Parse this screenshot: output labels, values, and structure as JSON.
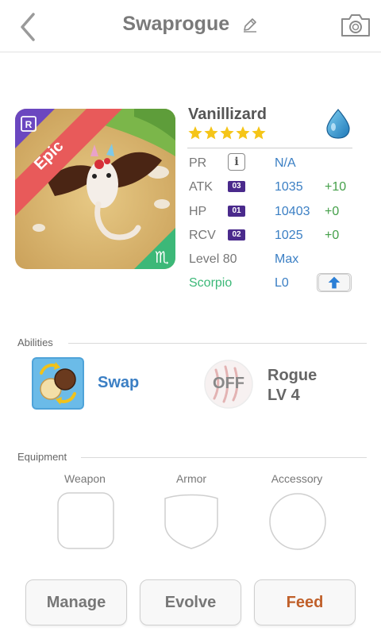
{
  "header": {
    "title": "Swaprogue",
    "back_icon": "back-chevron-icon",
    "edit_icon": "pencil-icon",
    "camera_icon": "camera-icon"
  },
  "monster": {
    "name": "Vanillizard",
    "rarity": "Epic",
    "rank_badge": "R",
    "zodiac_symbol": "♏",
    "star_count": 5,
    "element_icon": "water-drop-icon",
    "stats": {
      "pr": {
        "label": "PR",
        "value": "N/A"
      },
      "atk": {
        "label": "ATK",
        "badge": "03",
        "value": "1035",
        "bonus": "+10"
      },
      "hp": {
        "label": "HP",
        "badge": "01",
        "value": "10403",
        "bonus": "+0"
      },
      "rcv": {
        "label": "RCV",
        "badge": "02",
        "value": "1025",
        "bonus": "+0"
      },
      "level": {
        "label": "Level 80",
        "value": "Max"
      },
      "zodiac": {
        "label": "Scorpio",
        "value": "L0"
      }
    }
  },
  "abilities": {
    "section_title": "Abilities",
    "swap": {
      "name": "Swap"
    },
    "rogue": {
      "state": "OFF",
      "name": "Rogue",
      "level": "LV 4"
    }
  },
  "equipment": {
    "section_title": "Equipment",
    "weapon_label": "Weapon",
    "armor_label": "Armor",
    "accessory_label": "Accessory"
  },
  "actions": {
    "manage": "Manage",
    "evolve": "Evolve",
    "feed": "Feed"
  },
  "colors": {
    "value_blue": "#3b7fc4",
    "bonus_green": "#45a04a",
    "zodiac_green": "#3cb878",
    "badge_purple": "#4a2a8c",
    "feed_orange": "#c0602a",
    "epic_red": "#e85a5a"
  }
}
